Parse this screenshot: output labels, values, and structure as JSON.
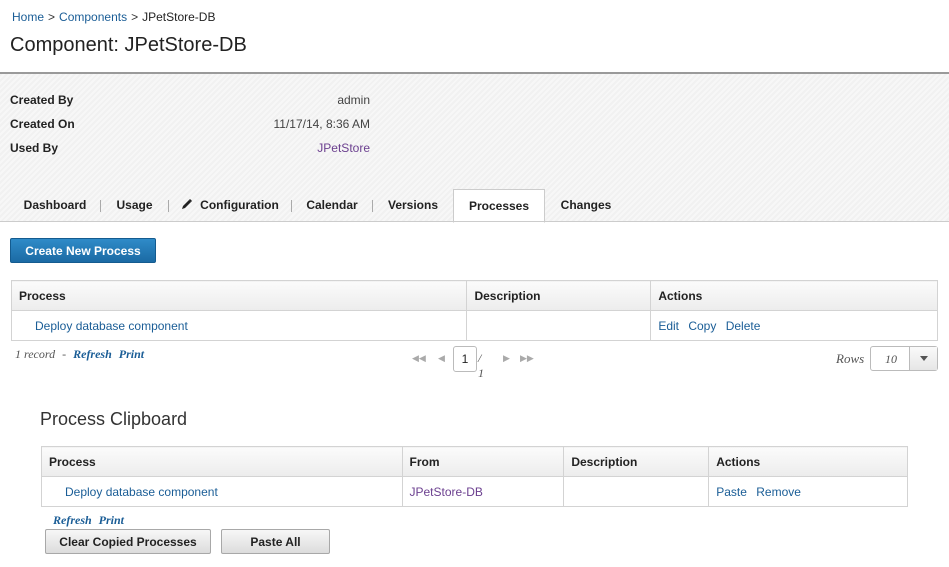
{
  "breadcrumb": {
    "home": "Home",
    "components": "Components",
    "current": "JPetStore-DB",
    "sep": ">"
  },
  "page_title": "Component: JPetStore-DB",
  "info": {
    "created_by_label": "Created By",
    "created_by": "admin",
    "created_on_label": "Created On",
    "created_on": "11/17/14, 8:36 AM",
    "used_by_label": "Used By",
    "used_by": "JPetStore"
  },
  "tabs": [
    {
      "label": "Dashboard"
    },
    {
      "label": "Usage"
    },
    {
      "label": "Configuration",
      "icon": "pencil-icon"
    },
    {
      "label": "Calendar"
    },
    {
      "label": "Versions"
    },
    {
      "label": "Processes",
      "active": true
    },
    {
      "label": "Changes"
    }
  ],
  "create_button": "Create New Process",
  "process_table": {
    "headers": [
      "Process",
      "Description",
      "Actions"
    ],
    "rows": [
      {
        "process": "Deploy database component",
        "description": "",
        "actions": [
          "Edit",
          "Copy",
          "Delete"
        ]
      }
    ]
  },
  "list_meta": {
    "records": "1 record",
    "dash": "-",
    "refresh": "Refresh",
    "print": "Print"
  },
  "pager": {
    "page": "1",
    "of": "/ 1"
  },
  "rows_per_page": {
    "label": "Rows",
    "value": "10"
  },
  "clipboard": {
    "title": "Process Clipboard",
    "headers": [
      "Process",
      "From",
      "Description",
      "Actions"
    ],
    "rows": [
      {
        "process": "Deploy database component",
        "from": "JPetStore-DB",
        "description": "",
        "actions": [
          "Paste",
          "Remove"
        ]
      }
    ],
    "refresh": "Refresh",
    "print": "Print",
    "clear_button": "Clear Copied Processes",
    "paste_all_button": "Paste All"
  },
  "colors": {
    "accent": "#1b6aa4",
    "link": "#1a5d96",
    "used_by_link": "#6b3f8f"
  }
}
